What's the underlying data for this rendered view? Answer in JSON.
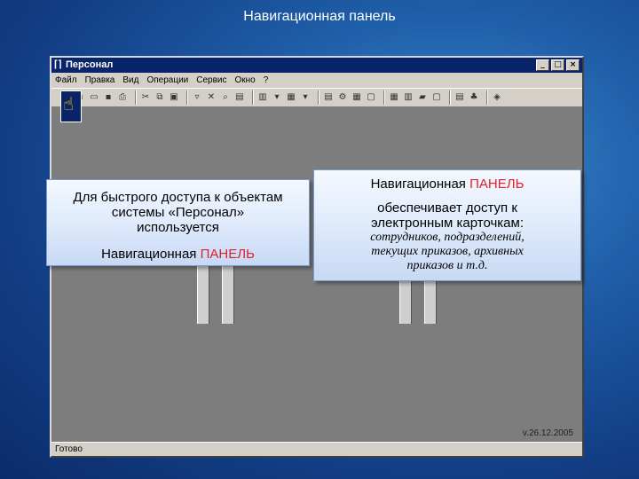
{
  "slide": {
    "title": "Навигационная панель"
  },
  "window": {
    "title": "Персонал",
    "controls": {
      "minimize": "_",
      "maximize": "□",
      "close": "×"
    }
  },
  "menu": {
    "items": [
      "Файл",
      "Правка",
      "Вид",
      "Операции",
      "Сервис",
      "Окно",
      "?"
    ]
  },
  "toolbar": {
    "icons": [
      "new-icon",
      "open-icon",
      "save-icon",
      "print-icon",
      "cut-icon",
      "copy-icon",
      "paste-icon",
      "filter-icon",
      "delete-icon",
      "find-icon",
      "document-icon",
      "tree-icon",
      "sort-icon",
      "report-icon",
      "card-icon",
      "employee-icon",
      "settings-icon",
      "grid-icon",
      "calendar-icon",
      "help-icon"
    ]
  },
  "status": {
    "text": "Готово",
    "version": "v.26.12.2005"
  },
  "callout_left": {
    "lines": [
      "Для быстрого доступа к объектам",
      "системы «Персонал»",
      "используется"
    ],
    "nav_prefix": "Навигационная ",
    "nav_accent": "ПАНЕЛЬ"
  },
  "callout_right": {
    "nav_prefix": "Навигационная ",
    "nav_accent": "ПАНЕЛЬ",
    "desc_lines": [
      "обеспечивает доступ к",
      "электронным карточкам:"
    ],
    "italic_lines": [
      "сотрудников, подразделений,",
      "текущих приказов, архивных",
      "приказов и т.д."
    ]
  },
  "colors": {
    "accent": "#e0202a",
    "titlebar": "#0a246a",
    "background": "#1f5ea8"
  }
}
